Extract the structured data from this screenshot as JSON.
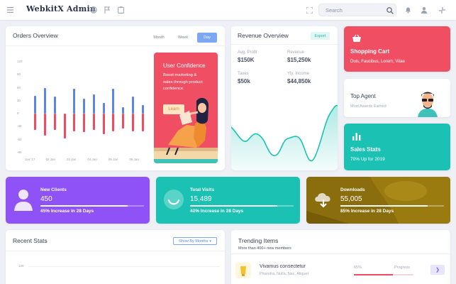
{
  "app": {
    "brand": "WebkitX Admin"
  },
  "search": {
    "placeholder": "Search"
  },
  "orders": {
    "title": "Orders Overview",
    "tabs": [
      "Month",
      "Week",
      "Day"
    ],
    "active_tab": "Day",
    "y_ticks": [
      "120",
      "90",
      "60",
      "30",
      "0",
      "-30",
      "-60",
      "-90"
    ],
    "x_ticks": [
      "Jan '17",
      "02 Jan",
      "03 Jan",
      "04 Jan",
      "05 Jan",
      "06 Jan"
    ]
  },
  "chart_data": {
    "type": "bar",
    "title": "Orders Overview",
    "ylim": [
      -90,
      120
    ],
    "x": [
      1,
      2,
      3,
      4,
      5,
      6,
      7,
      8,
      9,
      10,
      11,
      12
    ],
    "series": [
      {
        "color": "#5b86e5",
        "values": [
          42,
          60,
          40,
          0,
          57,
          35,
          45,
          25,
          57,
          15,
          40,
          20
        ]
      },
      {
        "color": "#ef4c63",
        "values": [
          -38,
          -50,
          -38,
          -58,
          -40,
          -42,
          -38,
          -48,
          -40,
          -35,
          -40,
          -40
        ]
      }
    ]
  },
  "confidence": {
    "title": "User Confidence",
    "text": "Boost marketing & sales through product confidence.",
    "button": "Learn"
  },
  "revenue": {
    "title": "Revenue Overview",
    "export": "Export",
    "stats": [
      {
        "label": "Avg. Profit",
        "value": "$150K"
      },
      {
        "label": "Revenue",
        "value": "$15,250k"
      },
      {
        "label": "Taxes",
        "value": "$50k"
      },
      {
        "label": "Yly. Income",
        "value": "$44,850k"
      }
    ]
  },
  "shopping": {
    "title": "Shopping Cart",
    "sub": "Duis, Faucibus, Lorem, Vitae"
  },
  "agent": {
    "title": "Top Agent",
    "sub": "Most Awards Earned"
  },
  "sales": {
    "title": "Sales Stats",
    "sub": "70% Up for 2019"
  },
  "clients": {
    "title": "New Clients",
    "value": "450",
    "sub": "45% Increase in 28 Days",
    "progress": 0.84
  },
  "visits": {
    "title": "Total Visits",
    "value": "15,489",
    "sub": "40% Increase in 28 Days",
    "progress": 0.84
  },
  "downloads": {
    "title": "Downloads",
    "value": "55,005",
    "sub": "85% Increase in 28 Days",
    "progress": 0.84
  },
  "recent": {
    "title": "Recent Stats",
    "dropdown": "Show By Months",
    "y_tick": "120"
  },
  "trending": {
    "title": "Trending Items",
    "sub": "More than 400+ new members",
    "item": {
      "name": "Vivamus consectetur",
      "tags": "Pharetra, Nulla, Nec, Aliquet",
      "percent": "65%",
      "status": "Progress",
      "progress": 0.65
    }
  },
  "colors": {
    "blue": "#5b86e5",
    "red": "#ef4c63",
    "purple": "#8e52f6",
    "teal": "#1bc2b4",
    "olive": "#87690a",
    "accent": "#7da7f5"
  }
}
